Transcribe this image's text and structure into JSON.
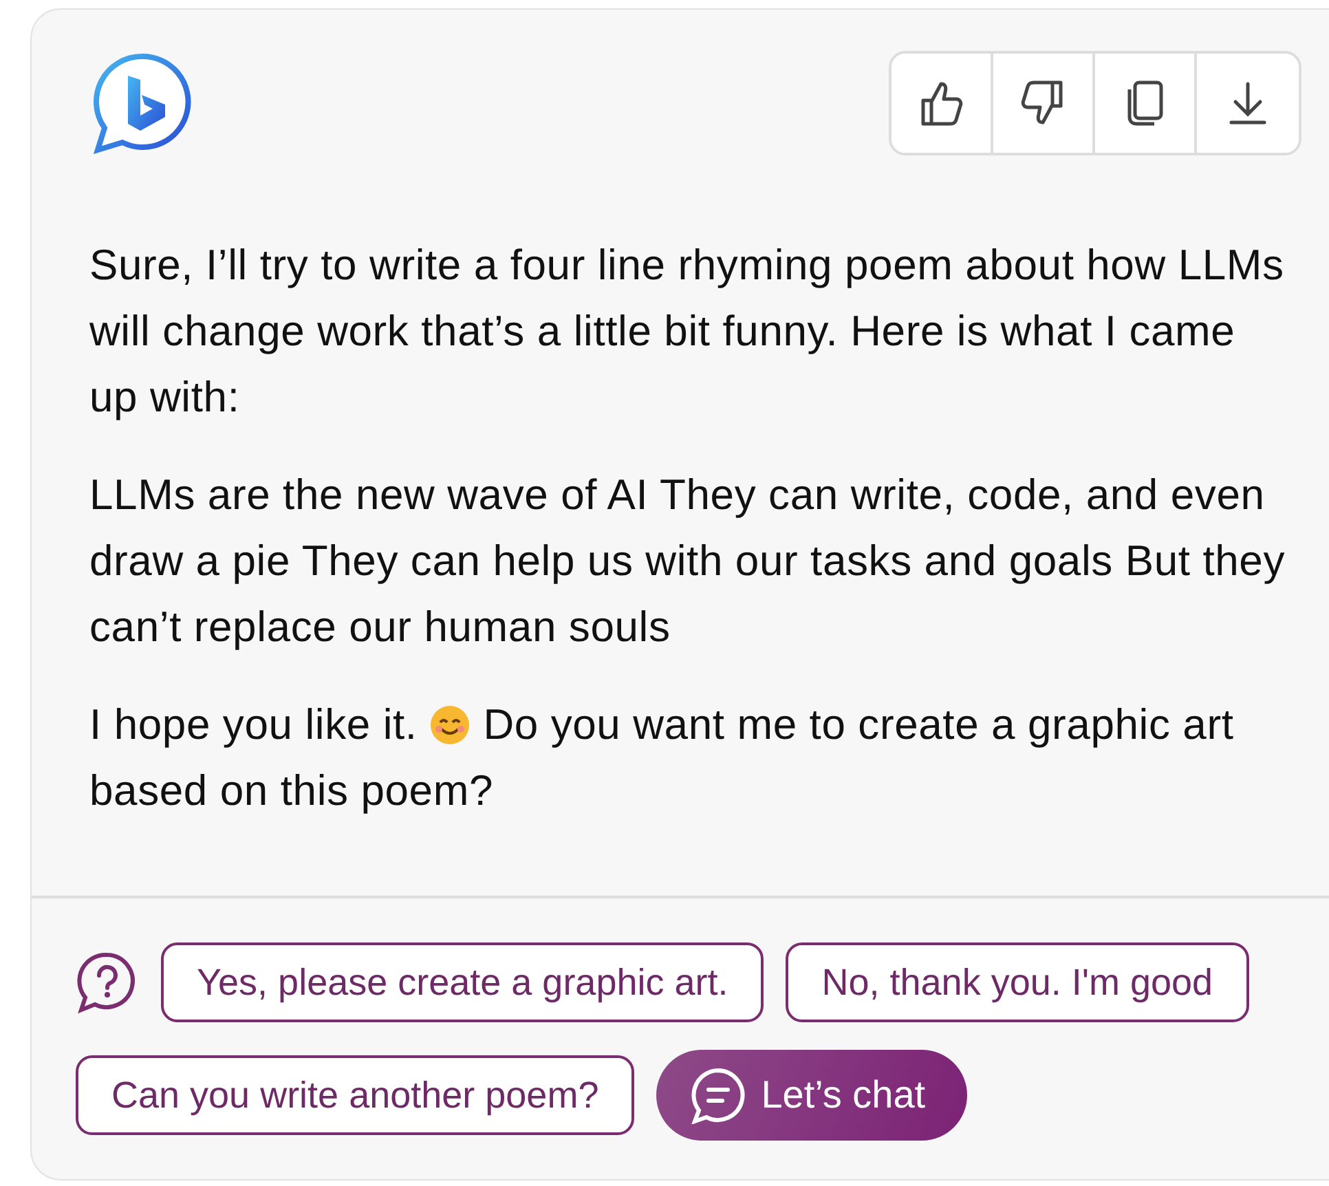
{
  "message": {
    "paragraphs": [
      {
        "text": "Sure, I’ll try to write a four line rhyming poem about how LLMs will change work that’s a little bit funny. Here is what I came up with:"
      },
      {
        "text": "LLMs are the new wave of AI They can write, code, and even draw a pie They can help us with our tasks and goals But they can’t replace our human souls"
      },
      {
        "text": "I hope you like it.",
        "after_emoji": [
          "Do you want me to create a graphic art",
          "based on this poem?"
        ]
      }
    ]
  },
  "suggestions": [
    "Yes, please create a graphic art.",
    "No, thank you. I'm good",
    "Can you write another poem?"
  ],
  "chat_button": {
    "label": "Let’s chat"
  }
}
